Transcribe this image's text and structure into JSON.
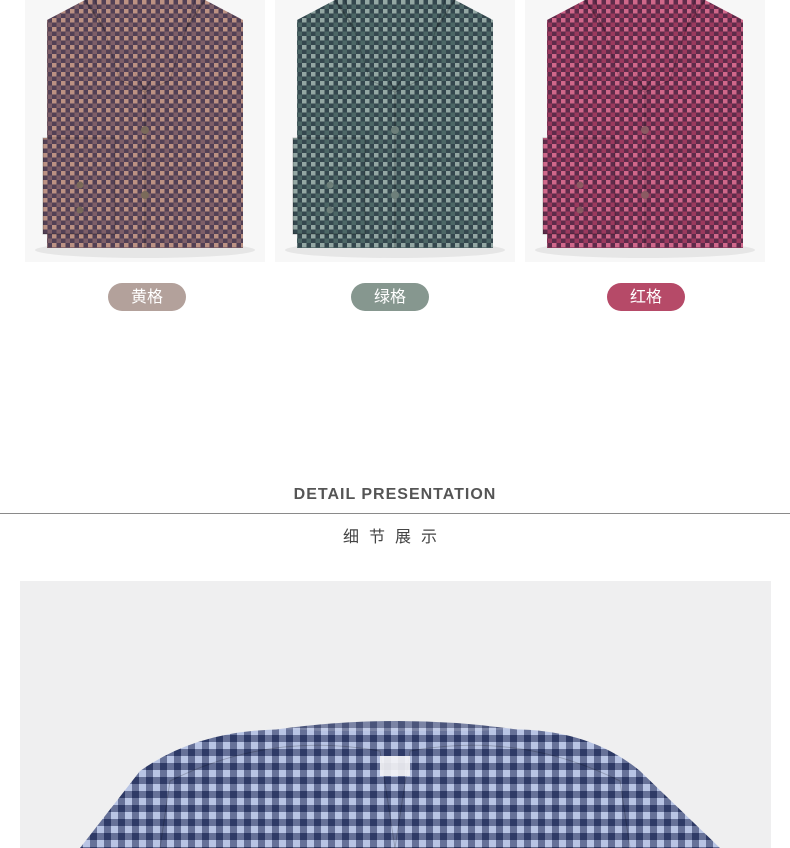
{
  "variants": [
    {
      "label": "黄格",
      "tag_color": "#b3a19b",
      "check_a": "#2d2745",
      "check_b": "#c99c8a",
      "base": "#7e5f68"
    },
    {
      "label": "绿格",
      "tag_color": "#86978f",
      "check_a": "#1f2d3b",
      "check_b": "#9fb3ad",
      "base": "#4d6766"
    },
    {
      "label": "红格",
      "tag_color": "#b64a68",
      "check_a": "#2b1f3a",
      "check_b": "#e06e93",
      "base": "#9b3a5e"
    }
  ],
  "section": {
    "title": "DETAIL PRESENTATION",
    "subtitle": "细节展示"
  },
  "detail": {
    "check_a": "#2e3a66",
    "check_b": "#b8c4e4"
  }
}
